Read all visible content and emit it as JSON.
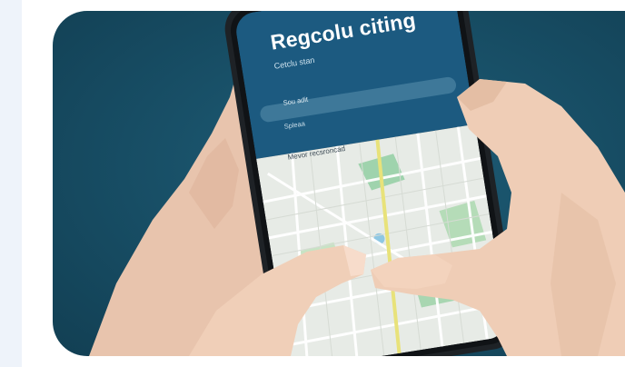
{
  "phone_screen": {
    "title": "Regcolu citing",
    "subtitle": "Cetclu stan",
    "field_value": "Sou adit",
    "field_label": "Spleaa",
    "map_label": "Mevor recsroncad"
  },
  "colors": {
    "card_background": "#174d64",
    "phone_header": "#1c5a80",
    "map_background": "#e7ebe6",
    "map_park": "#9fd3ad",
    "map_road_highlight": "#e8e27a"
  }
}
